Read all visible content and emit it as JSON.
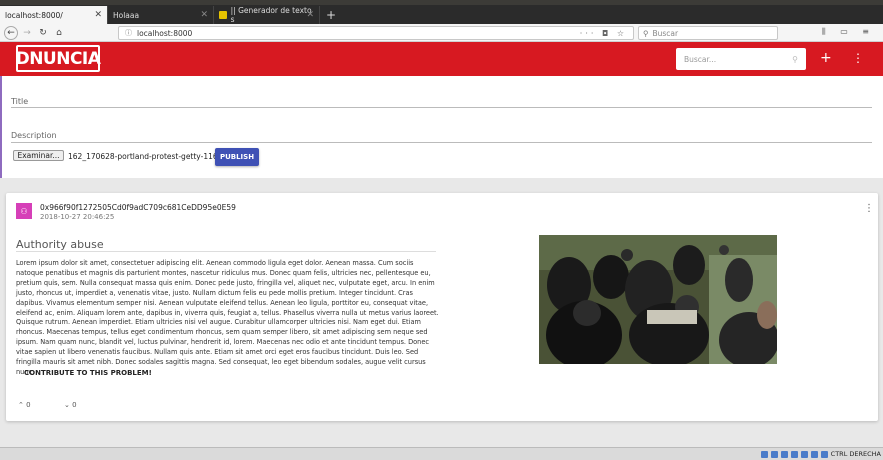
{
  "browser": {
    "tabs": [
      {
        "label": "localhost:8000/",
        "active": true
      },
      {
        "label": "Holaaa",
        "active": false
      },
      {
        "label": "|| Generador de texto s",
        "active": false
      }
    ],
    "url": "localhost:8000",
    "search_placeholder": "Buscar"
  },
  "app": {
    "logo": "DNUNCIA",
    "search_placeholder": "Buscar...",
    "accent": "#d71921"
  },
  "form": {
    "title_label": "Title",
    "description_label": "Description",
    "file_button": "Examinar...",
    "file_name": "162_170628-portland-protest-getty-1160.jpg",
    "publish_label": "PUBLISH"
  },
  "post": {
    "hash": "0x966f90f1272505Cd0f9adC709c681CeDD95e0E59",
    "date": "2018-10-27 20:46:25",
    "title": "Authority abuse",
    "body": "Lorem ipsum dolor sit amet, consectetuer adipiscing elit. Aenean commodo ligula eget dolor. Aenean massa. Cum sociis natoque penatibus et magnis dis parturient montes, nascetur ridiculus mus. Donec quam felis, ultricies nec, pellentesque eu, pretium quis, sem. Nulla consequat massa quis enim. Donec pede justo, fringilla vel, aliquet nec, vulputate eget, arcu. In enim justo, rhoncus ut, imperdiet a, venenatis vitae, justo. Nullam dictum felis eu pede mollis pretium. Integer tincidunt. Cras dapibus. Vivamus elementum semper nisi. Aenean vulputate eleifend tellus. Aenean leo ligula, porttitor eu, consequat vitae, eleifend ac, enim. Aliquam lorem ante, dapibus in, viverra quis, feugiat a, tellus. Phasellus viverra nulla ut metus varius laoreet. Quisque rutrum. Aenean imperdiet. Etiam ultricies nisi vel augue. Curabitur ullamcorper ultricies nisi. Nam eget dui. Etiam rhoncus. Maecenas tempus, tellus eget condimentum rhoncus, sem quam semper libero, sit amet adipiscing sem neque sed ipsum. Nam quam nunc, blandit vel, luctus pulvinar, hendrerit id, lorem. Maecenas nec odio et ante tincidunt tempus. Donec vitae sapien ut libero venenatis faucibus. Nullam quis ante. Etiam sit amet orci eget eros faucibus tincidunt. Duis leo. Sed fringilla mauris sit amet nibh. Donec sodales sagittis magna. Sed consequat, leo eget bibendum sodales, augue velit cursus nunc,",
    "contribute_label": "CONTRIBUTE TO THIS PROBLEM!",
    "upvotes": "0",
    "downvotes": "0"
  },
  "taskbar": {
    "label": "CTRL DERECHA"
  }
}
